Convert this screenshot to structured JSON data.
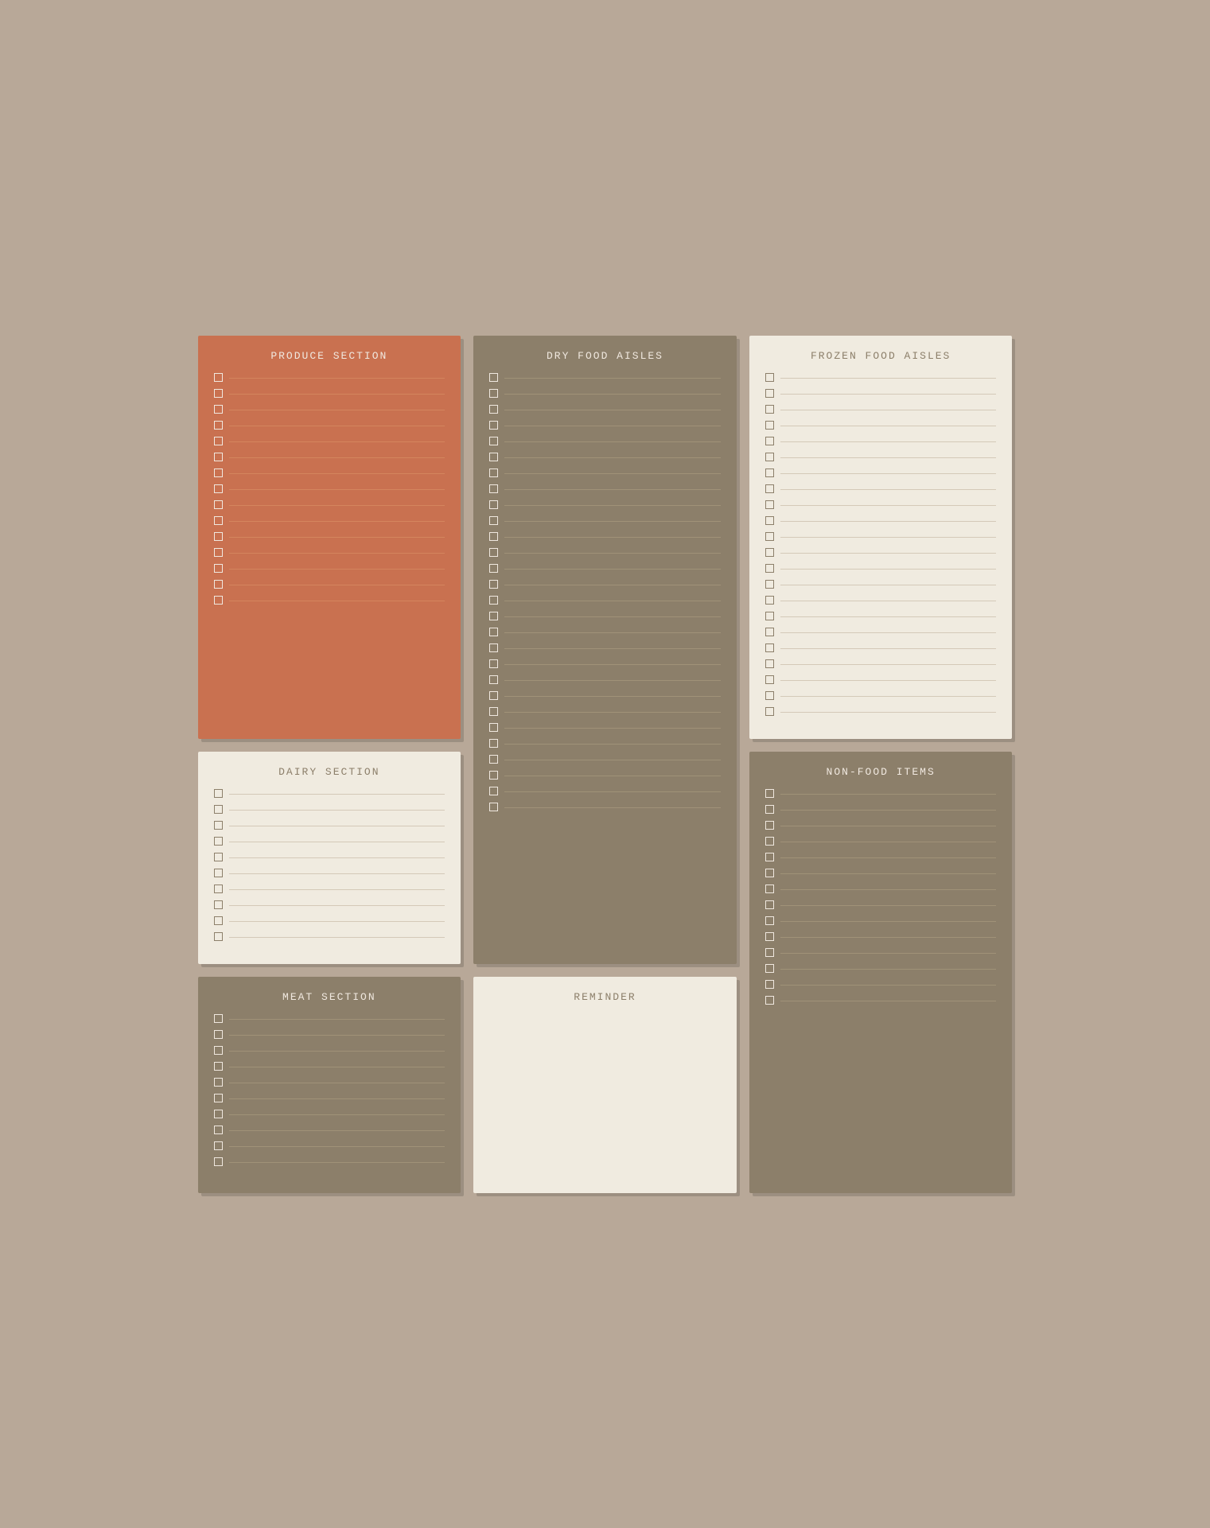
{
  "sections": {
    "produce": {
      "title": "PRODUCE SECTION",
      "rows": 15,
      "style": "produce"
    },
    "dry": {
      "title": "DRY FOOD AISLES",
      "rows": 28,
      "style": "dry"
    },
    "frozen": {
      "title": "FROZEN FOOD AISLES",
      "rows": 22,
      "style": "frozen"
    },
    "dairy": {
      "title": "DAIRY SECTION",
      "rows": 10,
      "style": "dairy"
    },
    "nonfood": {
      "title": "NON-FOOD ITEMS",
      "rows": 14,
      "style": "nonfood"
    },
    "meat": {
      "title": "MEAT SECTION",
      "rows": 10,
      "style": "meat"
    },
    "reminder": {
      "title": "REMINDER",
      "style": "reminder"
    }
  }
}
